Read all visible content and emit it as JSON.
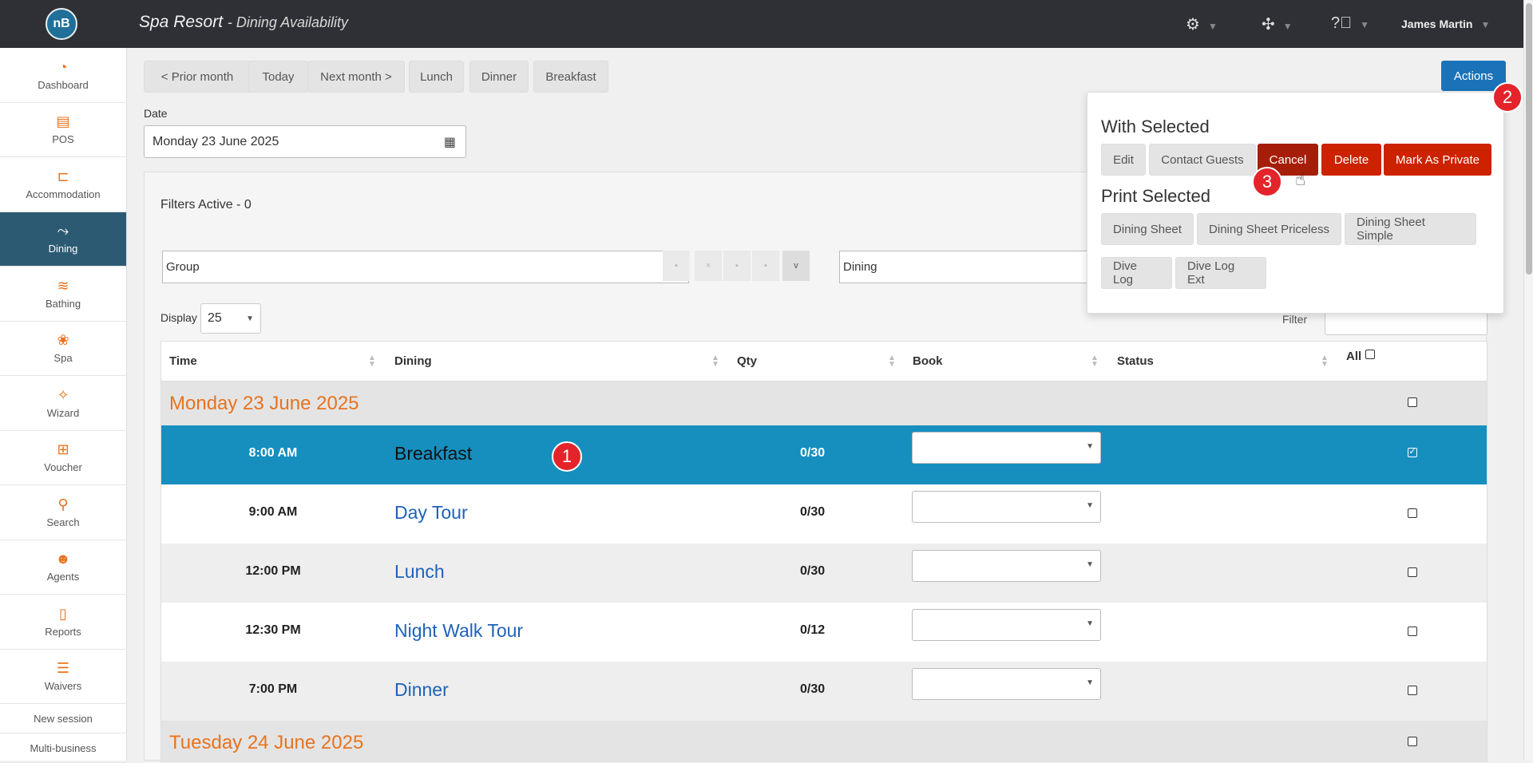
{
  "topbar": {
    "logo": "nB",
    "title": "Spa Resort",
    "subtitle": "Dining Availability",
    "icons": [
      "settings-gear-icon",
      "puzzle-icon",
      "help-icon"
    ],
    "user": "James Martin"
  },
  "sidebar": {
    "items": [
      {
        "label": "Dashboard",
        "icon": "dashboard-icon"
      },
      {
        "label": "POS",
        "icon": "register-icon"
      },
      {
        "label": "Accommodation",
        "icon": "bed-icon"
      },
      {
        "label": "Dining",
        "icon": "dining-icon"
      },
      {
        "label": "Bathing",
        "icon": "water-icon"
      },
      {
        "label": "Spa",
        "icon": "lotus-icon"
      },
      {
        "label": "Wizard",
        "icon": "wand-icon"
      },
      {
        "label": "Voucher",
        "icon": "gift-icon"
      },
      {
        "label": "Search",
        "icon": "search-icon"
      },
      {
        "label": "Agents",
        "icon": "agents-icon"
      },
      {
        "label": "Reports",
        "icon": "report-icon"
      },
      {
        "label": "Waivers",
        "icon": "list-icon"
      }
    ],
    "links": [
      "New session",
      "Multi-business"
    ]
  },
  "toolbar": {
    "prior_month": "< Prior month",
    "today": "Today",
    "next_month": "Next month >",
    "lunch": "Lunch",
    "dinner": "Dinner",
    "breakfast": "Breakfast",
    "actions": "Actions"
  },
  "date": {
    "label": "Date",
    "value": "Monday 23 June 2025"
  },
  "filters": {
    "active": "Filters Active - 0",
    "group_value": "Group",
    "dining_value": "Dining",
    "display_label": "Display",
    "display_value": "25",
    "filter_label": "Filter"
  },
  "table": {
    "headers": [
      "Time",
      "Dining",
      "Qty",
      "Book",
      "Status",
      "All"
    ],
    "date_groups": [
      "Monday 23 June 2025",
      "Tuesday 24 June 2025"
    ],
    "rows": [
      {
        "time": "8:00 AM",
        "dining": "Breakfast",
        "qty": "0/30",
        "selected": true
      },
      {
        "time": "9:00 AM",
        "dining": "Day Tour",
        "qty": "0/30",
        "selected": false
      },
      {
        "time": "12:00 PM",
        "dining": "Lunch",
        "qty": "0/30",
        "selected": false
      },
      {
        "time": "12:30 PM",
        "dining": "Night Walk Tour",
        "qty": "0/12",
        "selected": false
      },
      {
        "time": "7:00 PM",
        "dining": "Dinner",
        "qty": "0/30",
        "selected": false
      }
    ]
  },
  "actions_menu": {
    "with_selected": "With Selected",
    "with_buttons": [
      "Edit",
      "Contact Guests",
      "Cancel",
      "Delete",
      "Mark As Private"
    ],
    "print_selected": "Print Selected",
    "print_buttons": [
      "Dining Sheet",
      "Dining Sheet Priceless",
      "Dining Sheet Simple",
      "Dive Log",
      "Dive Log Ext"
    ]
  },
  "markers": [
    "1",
    "2",
    "3"
  ],
  "colors": {
    "topbar": "#2f3035",
    "accent_orange": "#e8731e",
    "selected_row": "#168fbf",
    "active_nav": "#2c5a73",
    "actions_blue": "#1a73b8",
    "danger_red": "#cc2200"
  }
}
